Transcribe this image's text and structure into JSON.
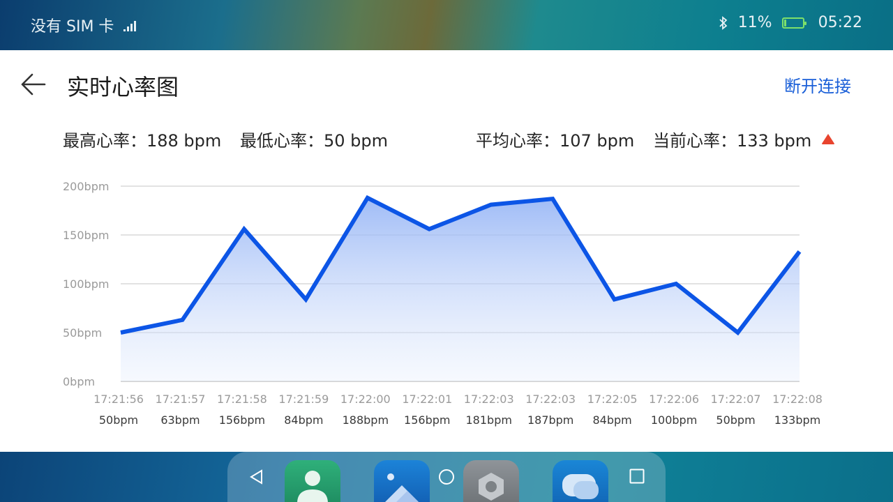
{
  "status_bar": {
    "carrier": "没有 SIM 卡",
    "battery": "11%",
    "battery_level": 0.11,
    "time": "05:22",
    "icons": [
      "signal-icon",
      "bluetooth-icon",
      "battery-icon"
    ]
  },
  "header": {
    "title": "实时心率图",
    "disconnect_label": "断开连接"
  },
  "stats": {
    "max": "最高心率：188 bpm",
    "min": "最低心率：50 bpm",
    "avg": "平均心率：107 bpm",
    "current": "当前心率：133 bpm"
  },
  "colors": {
    "accent": "#1a5fd8",
    "line": "#0c55e6",
    "trend_up": "#e8442e"
  },
  "chart_data": {
    "type": "area",
    "y_ticks": [
      "0bpm",
      "50bpm",
      "100bpm",
      "150bpm",
      "200bpm"
    ],
    "ylim": [
      0,
      200
    ],
    "x": [
      "17:21:56",
      "17:21:57",
      "17:21:58",
      "17:21:59",
      "17:22:00",
      "17:22:01",
      "17:22:03",
      "17:22:03",
      "17:22:05",
      "17:22:06",
      "17:22:07",
      "17:22:08"
    ],
    "value_labels": [
      "50bpm",
      "63bpm",
      "156bpm",
      "84bpm",
      "188bpm",
      "156bpm",
      "181bpm",
      "187bpm",
      "84bpm",
      "100bpm",
      "50bpm",
      "133bpm"
    ],
    "values": [
      50,
      63,
      156,
      84,
      188,
      156,
      181,
      187,
      84,
      100,
      50,
      133
    ],
    "grid": true
  },
  "nav": {
    "apps": [
      "contacts-icon",
      "gallery-icon",
      "settings-icon",
      "messages-icon"
    ]
  }
}
